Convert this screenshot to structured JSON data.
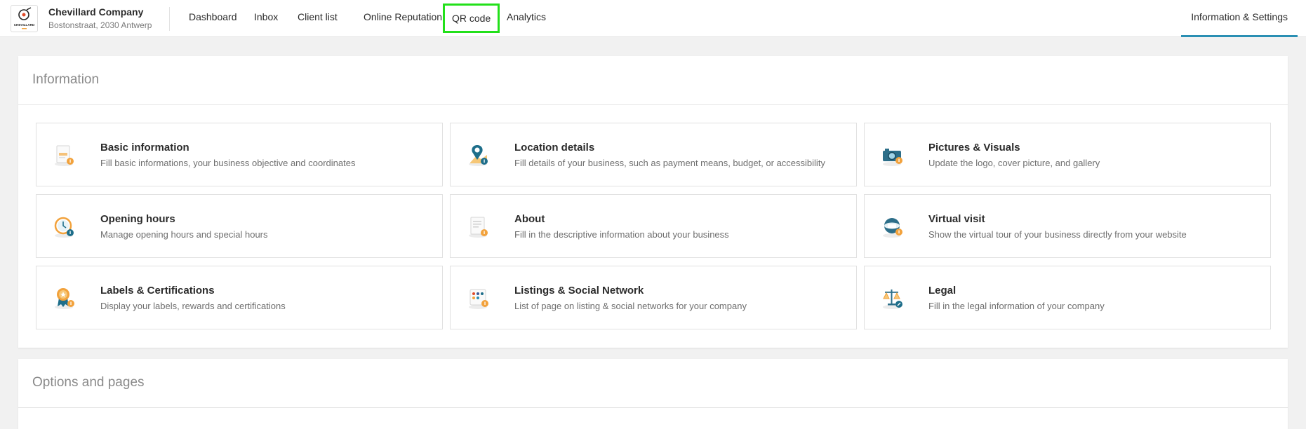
{
  "header": {
    "company_name": "Chevillard Company",
    "company_address": "Bostonstraat, 2030 Antwerp",
    "logo_text": "CHEVILLARD",
    "nav": [
      {
        "label": "Dashboard"
      },
      {
        "label": "Inbox"
      },
      {
        "label": "Client list"
      },
      {
        "label": "Online Reputation"
      },
      {
        "label": "QR code"
      },
      {
        "label": "Analytics"
      }
    ],
    "right_tab": "Information & Settings",
    "colors": {
      "accent": "#2a8fb3",
      "highlight": "#22e01a",
      "icon_orange": "#f2a23c",
      "icon_blue": "#1e6e8a"
    }
  },
  "information": {
    "title": "Information",
    "cards": [
      {
        "title": "Basic information",
        "desc": "Fill basic informations, your business objective and coordinates",
        "icon": "document-info-icon"
      },
      {
        "title": "Location details",
        "desc": "Fill details of your business, such as payment means, budget, or accessibility",
        "icon": "location-pin-icon"
      },
      {
        "title": "Pictures & Visuals",
        "desc": "Update the logo, cover picture, and gallery",
        "icon": "camera-icon"
      },
      {
        "title": "Opening hours",
        "desc": "Manage opening hours and special hours",
        "icon": "clock-icon"
      },
      {
        "title": "About",
        "desc": "Fill in the descriptive information about your business",
        "icon": "document-text-icon"
      },
      {
        "title": "Virtual visit",
        "desc": "Show the virtual tour of your business directly from your website",
        "icon": "360-view-icon"
      },
      {
        "title": "Labels & Certifications",
        "desc": "Display your labels, rewards and certifications",
        "icon": "award-badge-icon"
      },
      {
        "title": "Listings & Social Network",
        "desc": "List of page on listing & social networks for your company",
        "icon": "social-listing-icon"
      },
      {
        "title": "Legal",
        "desc": "Fill in the legal information of your company",
        "icon": "scales-icon"
      }
    ]
  },
  "options": {
    "title": "Options and pages"
  }
}
